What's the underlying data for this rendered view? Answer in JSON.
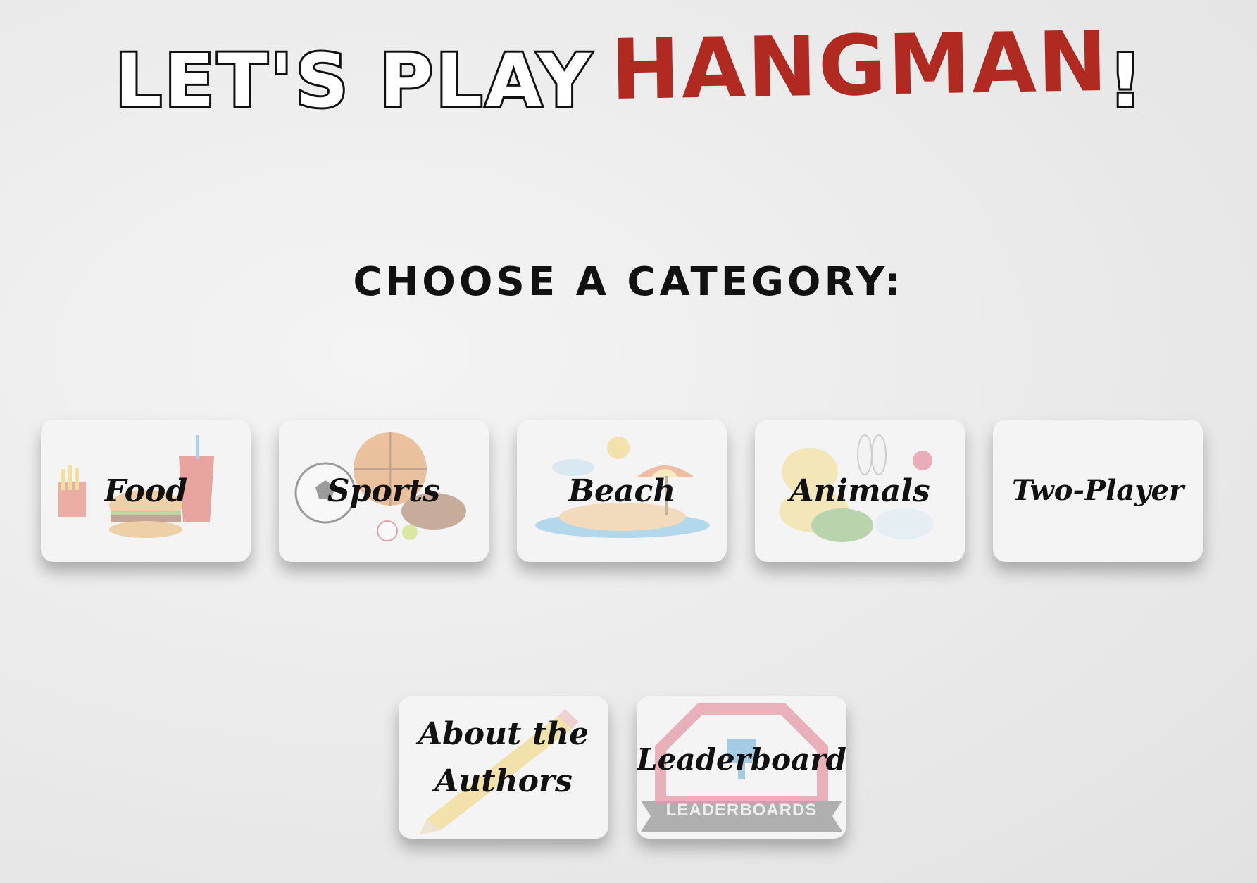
{
  "title": {
    "lead": "LET'S PLAY",
    "highlight": "HANGMAN",
    "bang": "!"
  },
  "subtitle": "CHOOSE A CATEGORY:",
  "categories": [
    {
      "label": "Food",
      "icon": "burger-fries-drink-icon"
    },
    {
      "label": "Sports",
      "icon": "sports-balls-icon"
    },
    {
      "label": "Beach",
      "icon": "beach-island-umbrella-icon"
    },
    {
      "label": "Animals",
      "icon": "animals-group-icon"
    },
    {
      "label": "Two-Player",
      "icon": ""
    }
  ],
  "extras": [
    {
      "label_line1": "About the",
      "label_line2": "Authors",
      "icon": "pencil-icon"
    },
    {
      "label": "Leaderboard",
      "icon": "leaderboards-badge-icon",
      "badge_text": "LEADERBOARDS"
    }
  ],
  "colors": {
    "accent": "#b02a22",
    "text": "#111111",
    "card": "#f4f4f4"
  }
}
